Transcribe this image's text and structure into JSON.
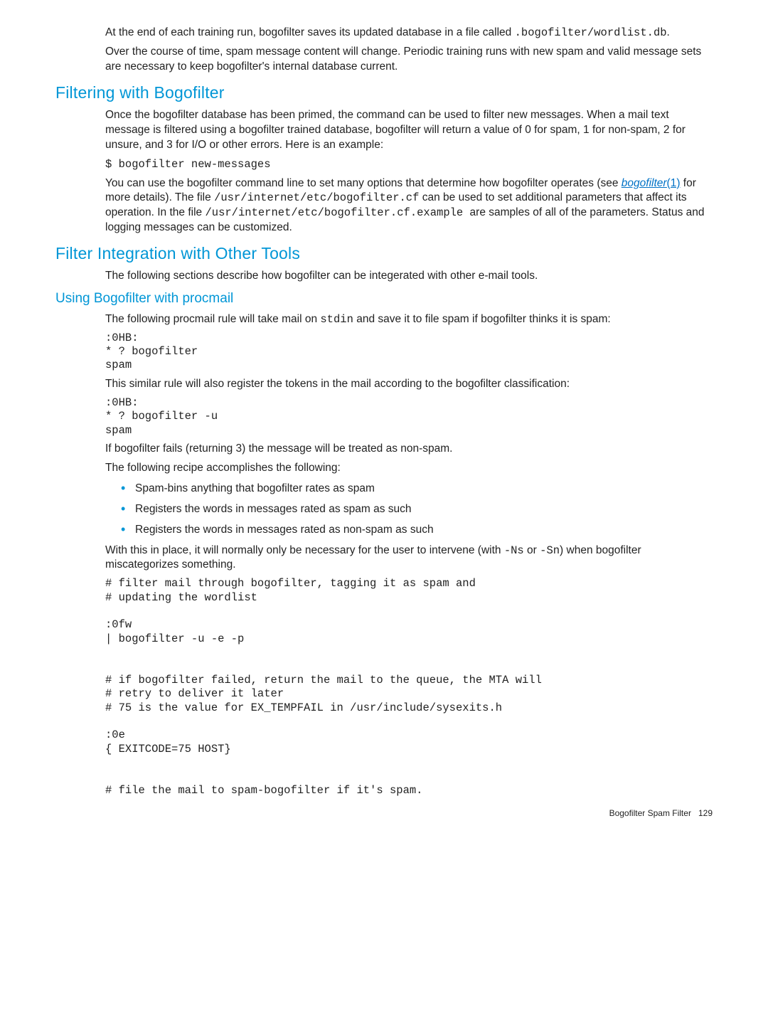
{
  "intro": {
    "p1a": "At the end of each training run, bogofilter saves its updated database in a file called ",
    "p1code": ".bogofilter/wordlist.db",
    "p1b": ".",
    "p2": "Over the course of time, spam message content will change. Periodic training runs with new spam and valid message sets are necessary to keep bogofilter's internal database current."
  },
  "sec1": {
    "heading": "Filtering with Bogofilter",
    "p1": "Once the bogofilter database has been primed, the command can be used to filter new messages. When a mail text message is filtered using a bogofilter trained database, bogofilter will return a value of 0 for spam, 1 for non-spam, 2 for unsure, and 3 for I/O or other errors. Here is an example:",
    "cmd1": "$ bogofilter new-messages",
    "p2a": "You can use the bogofilter command line to set many options that determine how bogofilter operates (see ",
    "link_label": "bogofilter",
    "link_man": "(1)",
    "p2b": " for more details). The file ",
    "p2code1": "/usr/internet/etc/bogofilter.cf",
    "p2c": " can be used to set additional parameters that affect its operation. In the file ",
    "p2code2": "/usr/internet/etc/bogofilter.cf.example ",
    "p2d": " are samples of all of the parameters. Status and logging messages can be customized."
  },
  "sec2": {
    "heading": "Filter Integration with Other Tools",
    "p1": "The following sections describe how bogofilter can be integerated with other e-mail tools."
  },
  "sec3": {
    "heading": "Using Bogofilter with procmail",
    "p1a": "The following procmail rule will take mail on ",
    "p1code": "stdin",
    "p1b": " and save it to file spam if bogofilter thinks it is spam:",
    "code1": ":0HB:\n* ? bogofilter\nspam",
    "p2": "This similar rule will also register the tokens in the mail according to the bogofilter classification:",
    "code2": ":0HB:\n* ? bogofilter -u\nspam",
    "p3": "If bogofilter fails (returning 3) the message will be treated as non-spam.",
    "p4": "The following recipe accomplishes the following:",
    "bullets": {
      "b1": "Spam-bins anything that bogofilter rates as spam",
      "b2": "Registers the words in messages rated as spam as such",
      "b3": "Registers the words in messages rated as non-spam as such"
    },
    "p5a": "With this in place, it will normally only be necessary for the user to intervene (with ",
    "p5code1": "-Ns",
    "p5b": " or ",
    "p5code2": "-Sn",
    "p5c": ") when bogofilter miscategorizes something.",
    "code3": "# filter mail through bogofilter, tagging it as spam and\n# updating the wordlist\n\n:0fw\n| bogofilter -u -e -p\n\n\n# if bogofilter failed, return the mail to the queue, the MTA will\n# retry to deliver it later\n# 75 is the value for EX_TEMPFAIL in /usr/include/sysexits.h\n\n:0e\n{ EXITCODE=75 HOST}\n\n\n# file the mail to spam-bogofilter if it's spam."
  },
  "footer": {
    "label": "Bogofilter Spam Filter",
    "page": "129"
  }
}
